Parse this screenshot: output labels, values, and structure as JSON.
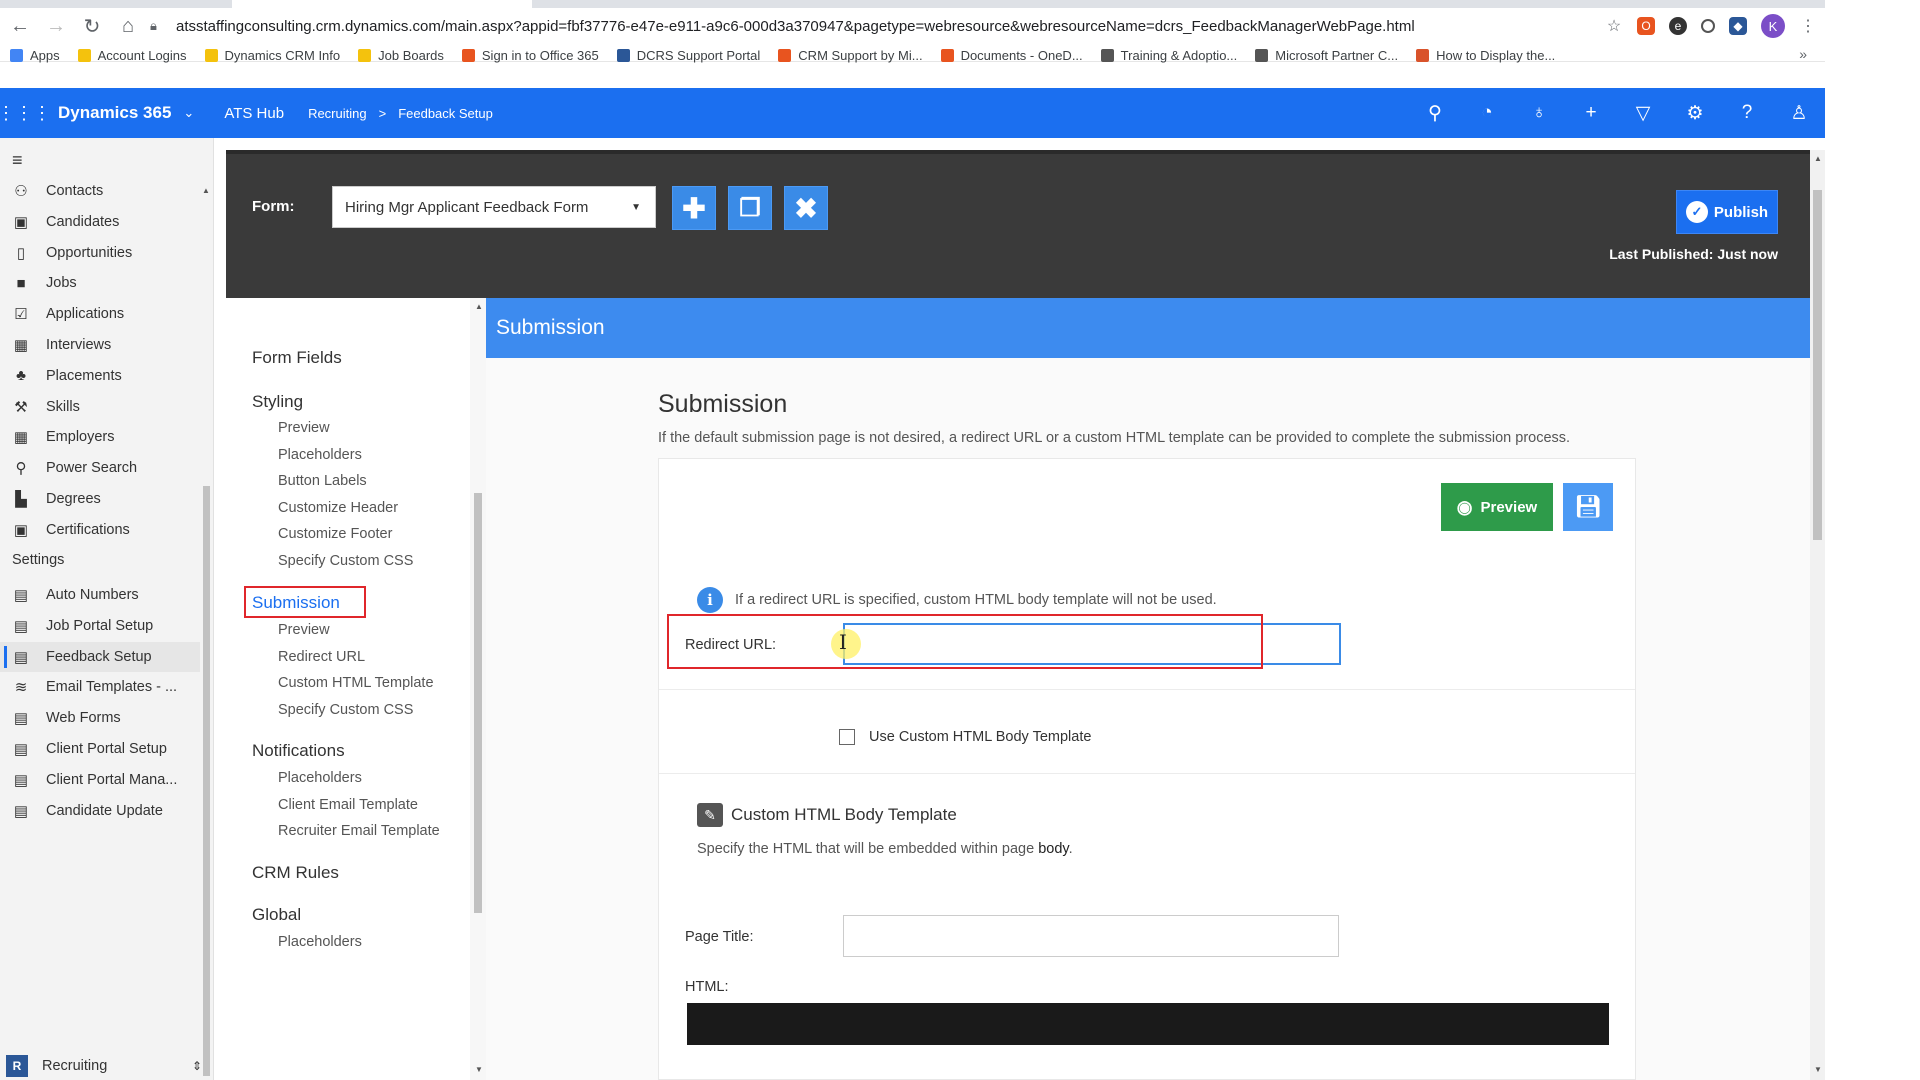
{
  "browser": {
    "url": "atsstaffingconsulting.crm.dynamics.com/main.aspx?appid=fbf37776-e47e-e911-a9c6-000d3a370947&pagetype=webresource&webresourceName=dcrs_FeedbackManagerWebPage.html",
    "profile_initial": "K",
    "bookmarks": [
      {
        "label": "Apps",
        "color": "#4285f4"
      },
      {
        "label": "Account Logins",
        "color": "#f4c20d"
      },
      {
        "label": "Dynamics CRM Info",
        "color": "#f4c20d"
      },
      {
        "label": "Job Boards",
        "color": "#f4c20d"
      },
      {
        "label": "Sign in to Office 365",
        "color": "#e8541f"
      },
      {
        "label": "DCRS Support Portal",
        "color": "#2b5797"
      },
      {
        "label": "CRM Support by Mi...",
        "color": "#e8541f"
      },
      {
        "label": "Documents - OneD...",
        "color": "#e8541f"
      },
      {
        "label": "Training & Adoptio...",
        "color": "#555555"
      },
      {
        "label": "Microsoft Partner C...",
        "color": "#555555"
      },
      {
        "label": "How to Display the...",
        "color": "#d9532b"
      }
    ],
    "bookmarks_more": "»"
  },
  "topbar": {
    "app_name": "Dynamics 365",
    "area": "ATS Hub",
    "breadcrumb_1": "Recruiting",
    "breadcrumb_sep": ">",
    "breadcrumb_2": "Feedback Setup",
    "icons": [
      "search-icon",
      "task-icon",
      "lightbulb-icon",
      "plus-icon",
      "filter-icon",
      "gear-icon",
      "help-icon",
      "user-icon"
    ],
    "color": "#1b6ff0"
  },
  "leftnav": {
    "items": [
      {
        "label": "Contacts",
        "icon": "person-icon",
        "glyph": "⚇"
      },
      {
        "label": "Candidates",
        "icon": "id-card-icon",
        "glyph": "▣"
      },
      {
        "label": "Opportunities",
        "icon": "document-icon",
        "glyph": "▯"
      },
      {
        "label": "Jobs",
        "icon": "briefcase-icon",
        "glyph": "■"
      },
      {
        "label": "Applications",
        "icon": "check-doc-icon",
        "glyph": "☑"
      },
      {
        "label": "Interviews",
        "icon": "calendar-icon",
        "glyph": "▦"
      },
      {
        "label": "Placements",
        "icon": "people-icon",
        "glyph": "♣"
      },
      {
        "label": "Skills",
        "icon": "tools-icon",
        "glyph": "⚒"
      },
      {
        "label": "Employers",
        "icon": "building-icon",
        "glyph": "▦"
      },
      {
        "label": "Power Search",
        "icon": "search-icon",
        "glyph": "⚲"
      },
      {
        "label": "Degrees",
        "icon": "book-icon",
        "glyph": "▙"
      },
      {
        "label": "Certifications",
        "icon": "certificate-icon",
        "glyph": "▣"
      }
    ],
    "settings_label": "Settings",
    "settings_items": [
      {
        "label": "Auto Numbers",
        "icon": "clipboard-icon",
        "glyph": "▤"
      },
      {
        "label": "Job Portal Setup",
        "icon": "clipboard-icon",
        "glyph": "▤"
      },
      {
        "label": "Feedback Setup",
        "icon": "clipboard-icon",
        "glyph": "▤",
        "selected": true
      },
      {
        "label": "Email Templates - ...",
        "icon": "layers-icon",
        "glyph": "≋"
      },
      {
        "label": "Web Forms",
        "icon": "clipboard-icon",
        "glyph": "▤"
      },
      {
        "label": "Client Portal Setup",
        "icon": "clipboard-icon",
        "glyph": "▤"
      },
      {
        "label": "Client Portal Mana...",
        "icon": "clipboard-icon",
        "glyph": "▤"
      },
      {
        "label": "Candidate Update",
        "icon": "clipboard-icon",
        "glyph": "▤"
      }
    ],
    "area_badge": "R",
    "area_label": "Recruiting"
  },
  "header": {
    "form_label": "Form:",
    "form_value": "Hiring Mgr Applicant Feedback Form",
    "publish_label": "Publish",
    "last_published": "Last Published: Just now"
  },
  "subnav": {
    "form_fields": "Form Fields",
    "styling": "Styling",
    "styling_items": [
      "Preview",
      "Placeholders",
      "Button Labels",
      "Customize Header",
      "Customize Footer",
      "Specify Custom CSS"
    ],
    "submission": "Submission",
    "submission_items": [
      "Preview",
      "Redirect URL",
      "Custom HTML Template",
      "Specify Custom CSS"
    ],
    "notifications": "Notifications",
    "notifications_items": [
      "Placeholders",
      "Client Email Template",
      "Recruiter Email Template"
    ],
    "crm_rules": "CRM Rules",
    "global": "Global",
    "global_items": [
      "Placeholders"
    ]
  },
  "main": {
    "band_title": "Submission",
    "section_title": "Submission",
    "section_desc": "If the default submission page is not desired, a redirect URL or a custom HTML template can be provided to complete the submission process.",
    "preview_label": "Preview",
    "info_text": "If a redirect URL is specified, custom HTML body template will not be used.",
    "redirect_label": "Redirect URL:",
    "redirect_value": "",
    "use_custom_label": "Use Custom HTML Body Template",
    "tpl_title": "Custom HTML Body Template",
    "tpl_desc_prefix": "Specify the HTML that will be embedded within page",
    "tpl_desc_bold": "body",
    "tpl_desc_suffix": ".",
    "page_title_label": "Page Title:",
    "page_title_value": "",
    "html_label": "HTML:"
  }
}
